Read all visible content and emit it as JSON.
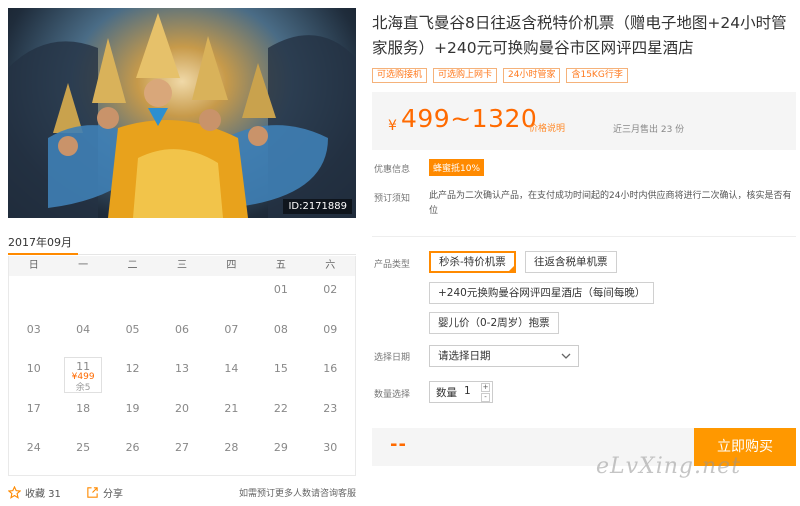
{
  "product": {
    "title": "北海直飞曼谷8日往返含税特价机票（赠电子地图+24小时管家服务）+240元可换购曼谷市区网评四星酒店",
    "image_id": "ID:2171889",
    "tags": [
      "可选购接机",
      "可选购上网卡",
      "24小时管家",
      "含15KG行李"
    ]
  },
  "price": {
    "currency": "¥",
    "range": "499~1320",
    "note": "价格说明",
    "sold": "近三月售出 23 份"
  },
  "info": {
    "promo_label": "优惠信息",
    "promo_badge": "蜂蜜抵10%",
    "notice_label": "预订须知",
    "notice_text": "此产品为二次确认产品，在支付成功时间起的24小时内供应商将进行二次确认，核实是否有位"
  },
  "options": {
    "type_label": "产品类型",
    "types": [
      {
        "label": "秒杀-特价机票",
        "selected": true
      },
      {
        "label": "往返含税单机票",
        "selected": false
      },
      {
        "label": "+240元换购曼谷网评四星酒店（每间每晚）",
        "selected": false
      },
      {
        "label": "婴儿价（0-2周岁）抱票",
        "selected": false
      }
    ],
    "date_label": "选择日期",
    "date_placeholder": "请选择日期",
    "qty_label": "数量选择",
    "qty_field_label": "数量",
    "qty_value": "1",
    "qty_plus": "+",
    "qty_minus": "-"
  },
  "buy": {
    "price_placeholder": "--",
    "button": "立即购买"
  },
  "calendar": {
    "month": "2017年09月",
    "weekdays": [
      "日",
      "一",
      "二",
      "三",
      "四",
      "五",
      "六"
    ],
    "days": [
      "",
      "",
      "",
      "",
      "",
      "01",
      "02",
      "03",
      "04",
      "05",
      "06",
      "07",
      "08",
      "09",
      "10",
      "11",
      "12",
      "13",
      "14",
      "15",
      "16",
      "17",
      "18",
      "19",
      "20",
      "21",
      "22",
      "23",
      "24",
      "25",
      "26",
      "27",
      "28",
      "29",
      "30"
    ],
    "special": {
      "day": "11",
      "price": "¥499",
      "remain": "余5"
    }
  },
  "footer": {
    "favorite": "收藏 31",
    "share": "分享",
    "note": "如需预订更多人数请咨询客服"
  },
  "watermark": "eLvXing.net",
  "colors": {
    "accent": "#ff8a00",
    "price": "#ff6a00",
    "tag_border": "#f5b27a"
  }
}
